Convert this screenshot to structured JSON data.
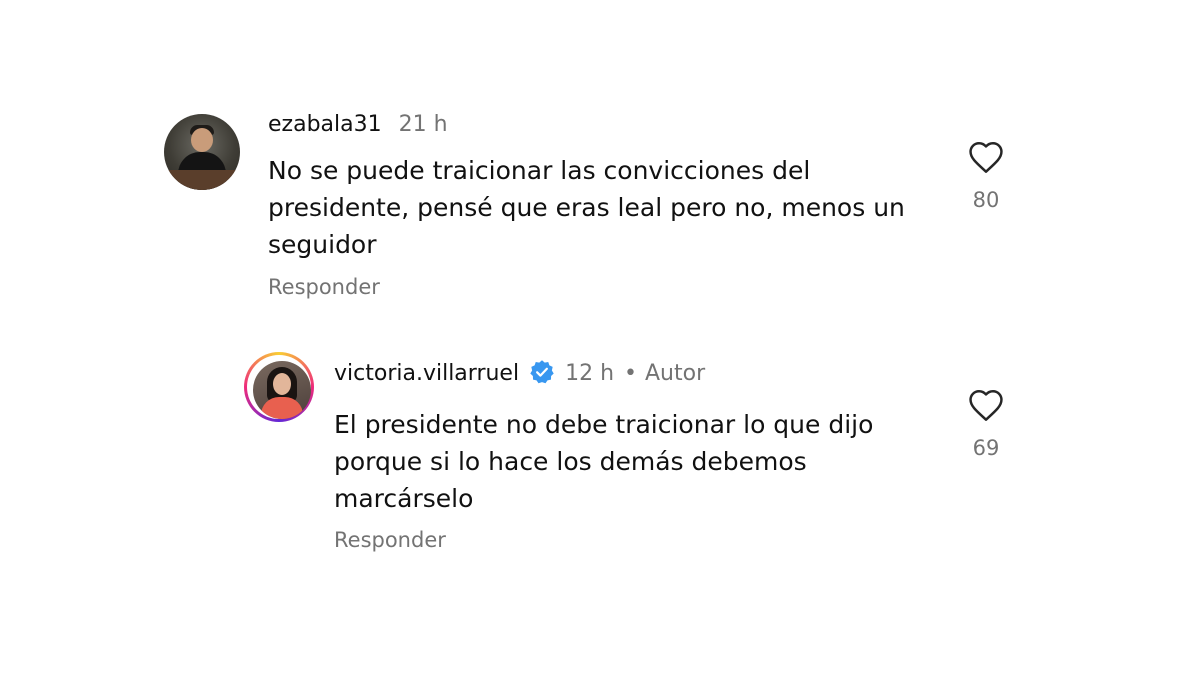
{
  "comments": [
    {
      "username": "ezabala31",
      "time": "21 h",
      "text": "No se puede traicionar las convicciones del presidente, pensé que eras leal pero no, menos un seguidor",
      "reply_label": "Responder",
      "likes": "80",
      "verified": false,
      "has_story": false
    },
    {
      "username": "victoria.villarruel",
      "time": "12 h",
      "separator": "•",
      "author_label": "Autor",
      "text": "El presidente no debe traicionar lo que dijo porque si lo hace los demás debemos marcárselo",
      "reply_label": "Responder",
      "likes": "69",
      "verified": true,
      "has_story": true
    }
  ],
  "icons": {
    "like": "heart-outline-icon",
    "verified": "verified-badge-icon"
  },
  "colors": {
    "text": "#111111",
    "secondary": "#737373",
    "verified": "#3897f0",
    "background": "#ffffff"
  }
}
